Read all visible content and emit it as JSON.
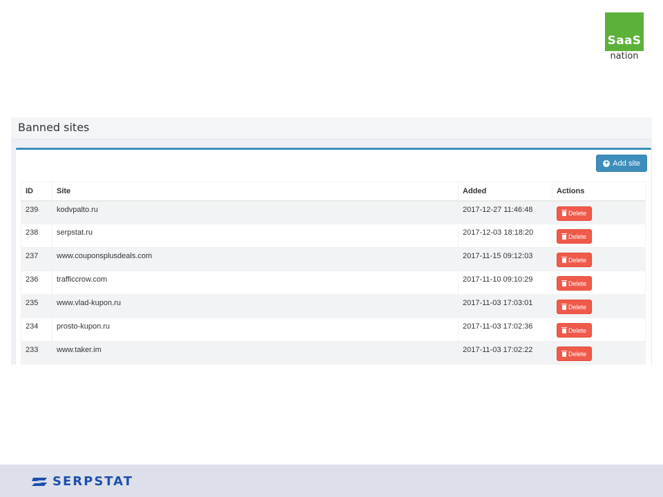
{
  "logo": {
    "top": "SaaS",
    "bottom": "nation",
    "color": "#5cb13a"
  },
  "page": {
    "title": "Banned sites"
  },
  "toolbar": {
    "add_label": "Add site"
  },
  "table": {
    "headers": [
      "ID",
      "Site",
      "Added",
      "Actions"
    ],
    "rows": [
      {
        "id": "239",
        "site": "kodvpalto.ru",
        "added": "2017-12-27 11:46:48",
        "action": "Delete"
      },
      {
        "id": "238",
        "site": "serpstat.ru",
        "added": "2017-12-03 18:18:20",
        "action": "Delete"
      },
      {
        "id": "237",
        "site": "www.couponsplusdeals.com",
        "added": "2017-11-15 09:12:03",
        "action": "Delete"
      },
      {
        "id": "236",
        "site": "trafficcrow.com",
        "added": "2017-11-10 09:10:29",
        "action": "Delete"
      },
      {
        "id": "235",
        "site": "www.vlad-kupon.ru",
        "added": "2017-11-03 17:03:01",
        "action": "Delete"
      },
      {
        "id": "234",
        "site": "prosto-kupon.ru",
        "added": "2017-11-03 17:02:36",
        "action": "Delete"
      },
      {
        "id": "233",
        "site": "www.taker.im",
        "added": "2017-11-03 17:02:22",
        "action": "Delete"
      }
    ]
  },
  "footer": {
    "brand": "SERPSTAT",
    "brand_color": "#1d4fb0"
  },
  "colors": {
    "primary": "#3c8dbc",
    "danger": "#f05a4a",
    "footer_bg": "#dde0eb"
  }
}
